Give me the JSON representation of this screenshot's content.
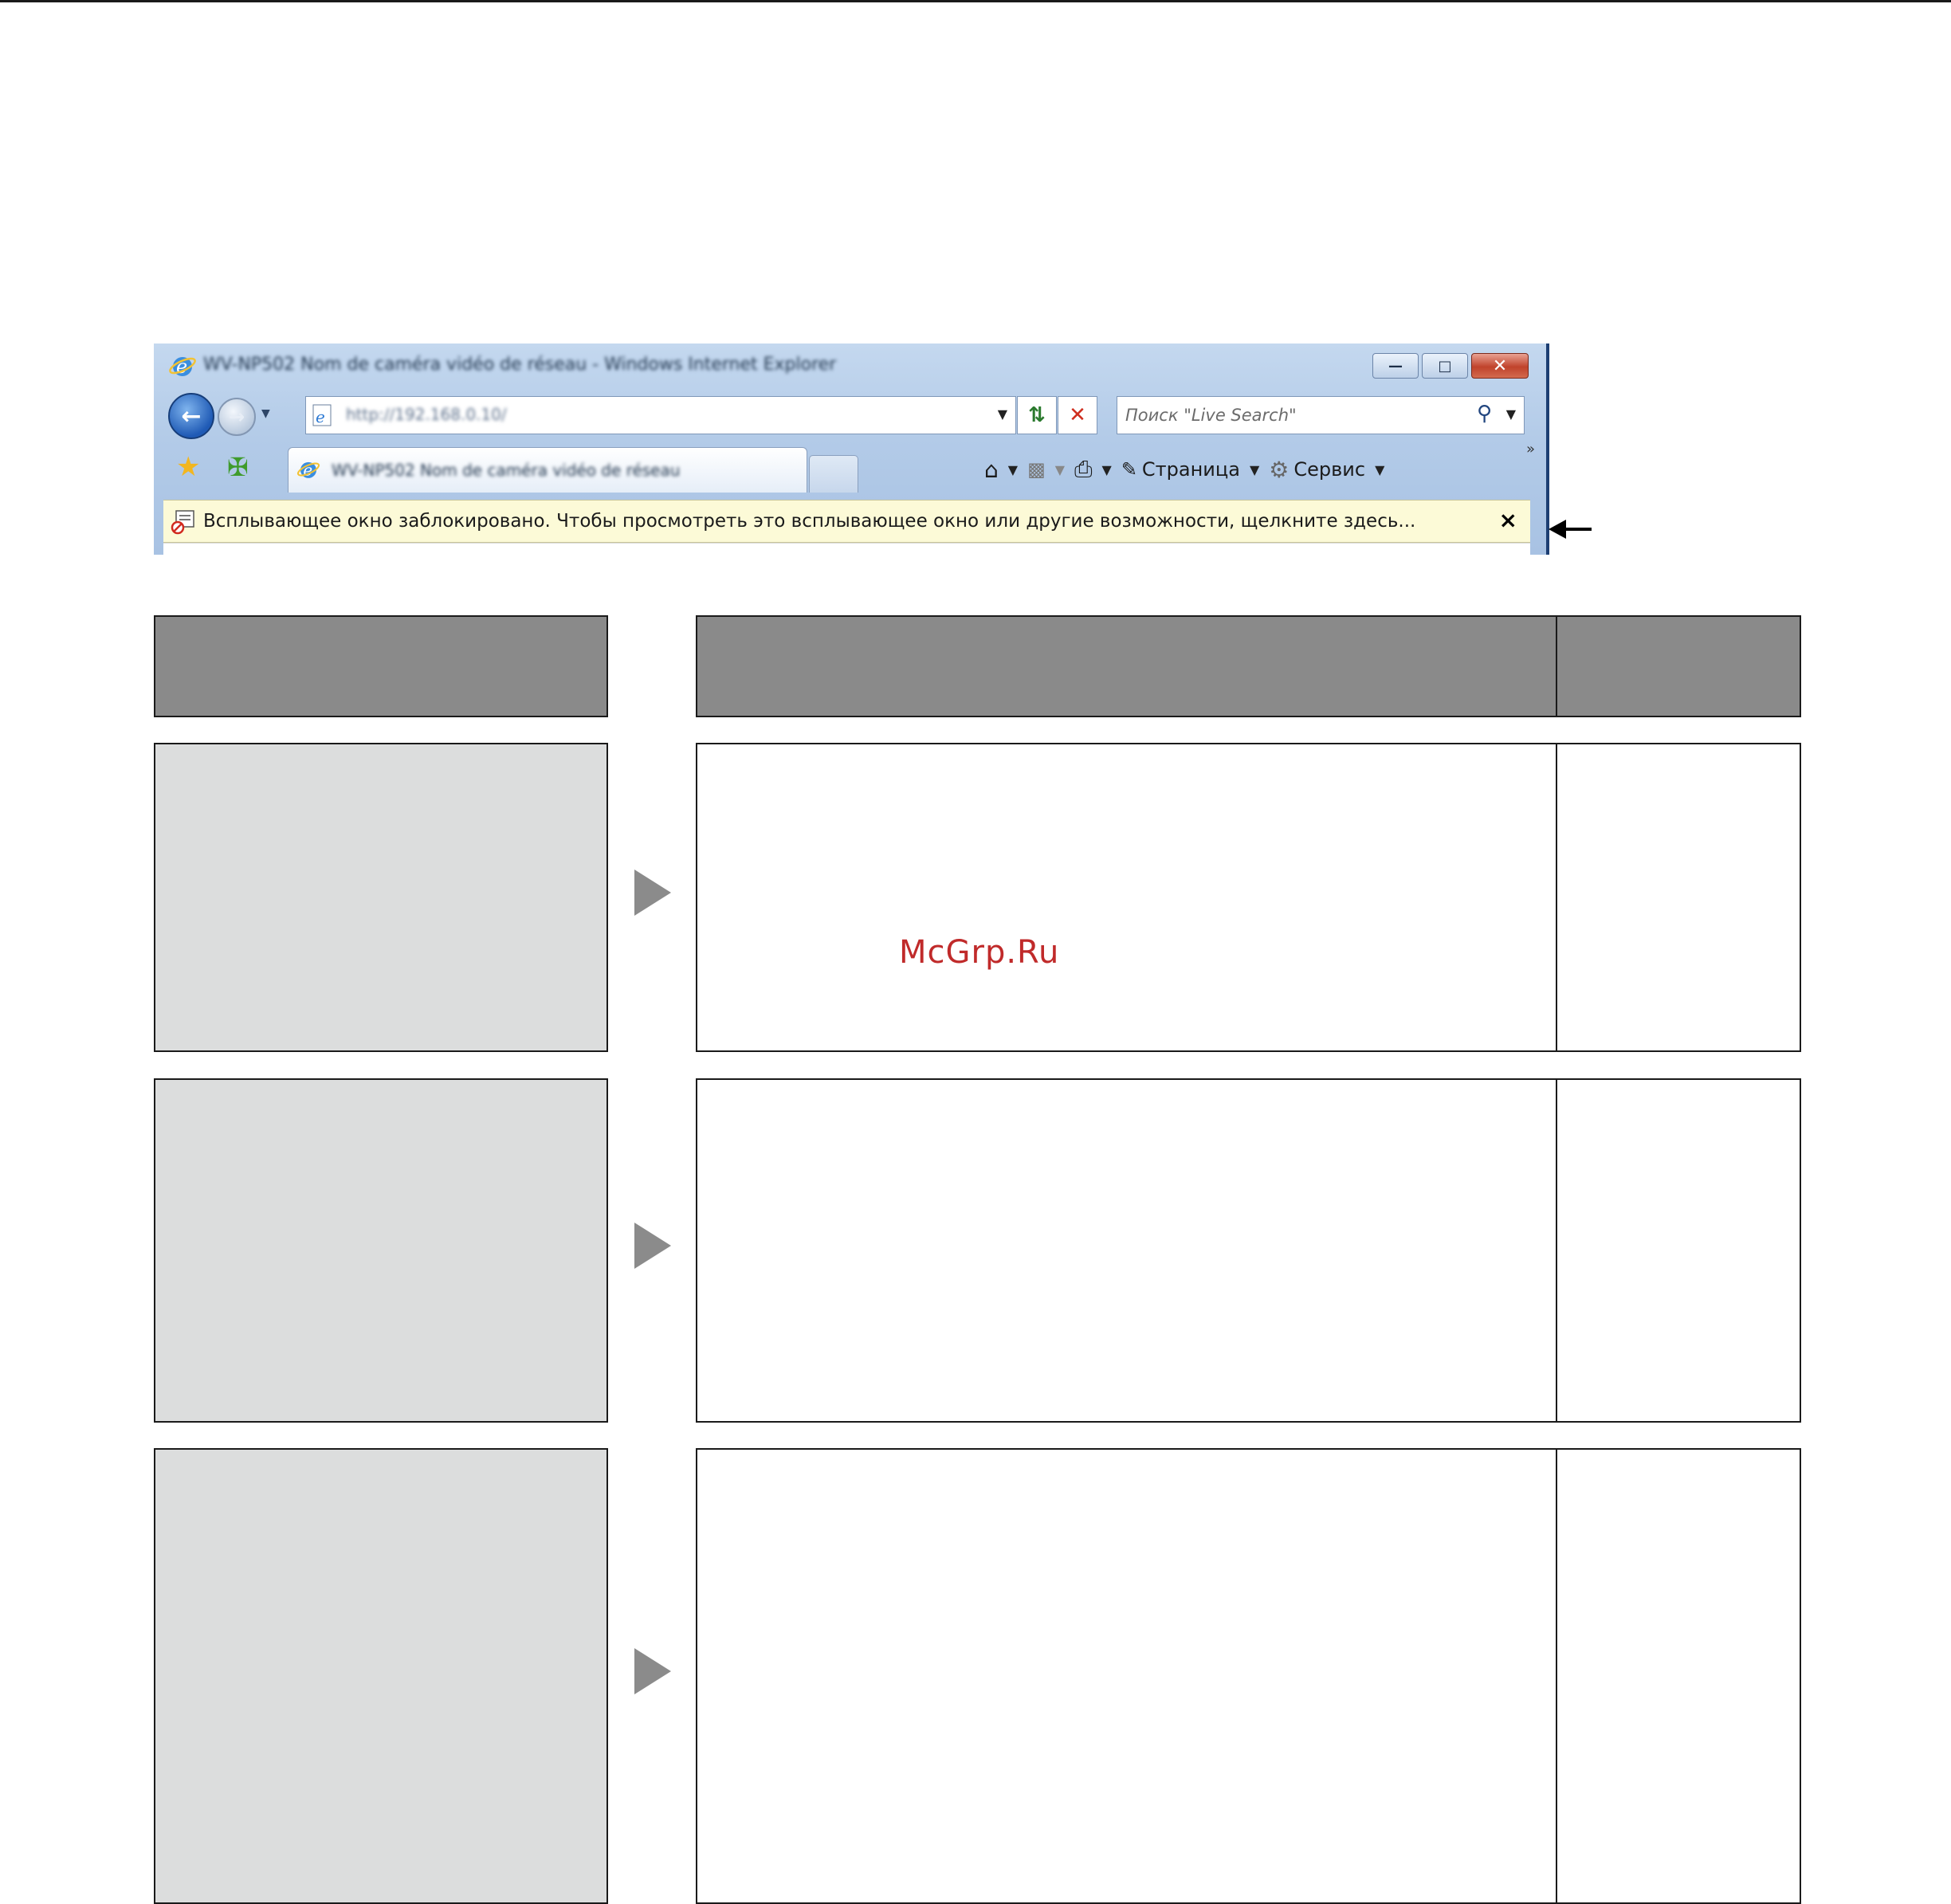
{
  "browser": {
    "window_title": "WV-NP502 Nom de caméra vidéo de réseau - Windows Internet Explorer",
    "address_url": "http://192.168.0.10/",
    "search_placeholder": "Поиск \"Live Search\"",
    "tab_title": "WV-NP502 Nom de caméra vidéo de réseau",
    "command_bar": {
      "page_label": "Страница",
      "tools_label": "Сервис",
      "more_label": "»"
    },
    "infobar_message": "Всплывающее окно заблокировано. Чтобы просмотреть это всплывающее окно или другие возможности, щелкните здесь...",
    "infobar_close": "×"
  },
  "watermark": "McGrp.Ru",
  "colors": {
    "header_fill": "#8a8a8a",
    "left_cell_fill": "#dcdddd",
    "triangle": "#8b8b8b",
    "watermark": "#c02a2a"
  }
}
